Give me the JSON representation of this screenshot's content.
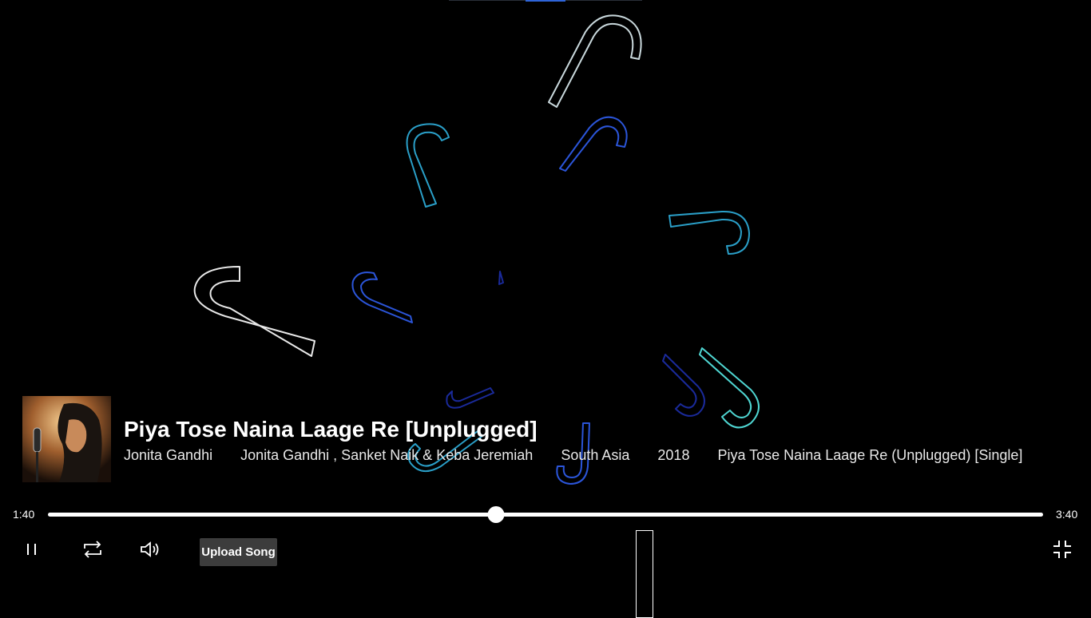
{
  "player": {
    "title": "Piya Tose Naina Laage Re [Unplugged]",
    "meta": [
      "Jonita Gandhi",
      "Jonita Gandhi , Sanket Naik & Keba Jeremiah",
      "South Asia",
      "2018",
      "Piya Tose Naina Laage Re (Unplugged) [Single]"
    ],
    "elapsed": "1:40",
    "duration": "3:40",
    "progress": 0.45,
    "upload_label": "Upload Song"
  },
  "icons": {
    "pause": "pause-icon",
    "repeat": "repeat-icon",
    "volume": "volume-icon",
    "exit_fullscreen": "exit-fullscreen-icon"
  },
  "colors": {
    "background": "#000000",
    "visualizer": [
      "#c9d8dc",
      "#2a9fc8",
      "#2b55d9",
      "#4fd6d2",
      "#1a2a9a",
      "#ffffff"
    ]
  }
}
